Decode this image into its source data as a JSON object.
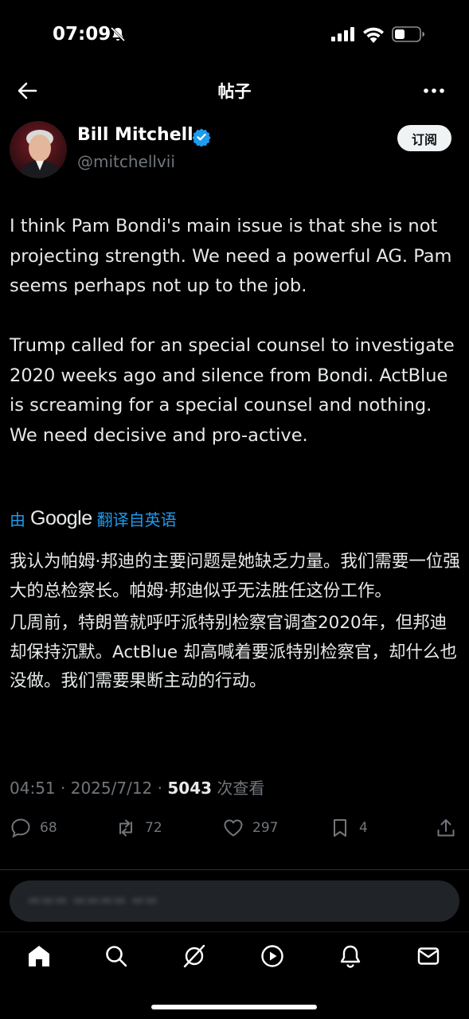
{
  "status_bar": {
    "time": "07:09"
  },
  "header": {
    "title": "帖子"
  },
  "author": {
    "name": "Bill Mitchell",
    "handle": "@mitchellvii",
    "subscribe_label": "订阅"
  },
  "tweet": {
    "paragraphs": [
      "I think Pam Bondi's main issue is that she is not projecting strength.  We need a powerful AG.  Pam seems perhaps not up to the job.",
      "Trump called for an special counsel to investigate 2020 weeks ago and silence from Bondi.  ActBlue is screaming for a special counsel and nothing.  We need decisive and pro-active."
    ]
  },
  "translation": {
    "prefix": "由",
    "provider": "Google",
    "suffix": "翻译自英语",
    "paragraphs": [
      "我认为帕姆·邦迪的主要问题是她缺乏力量。我们需要一位强大的总检察长。帕姆·邦迪似乎无法胜任这份工作。",
      "几周前，特朗普就呼吁派特别检察官调查2020年，但邦迪却保持沉默。ActBlue 却高喊着要派特别检察官，却什么也没做。我们需要果断主动的行动。"
    ]
  },
  "meta": {
    "time": "04:51",
    "date": "2025/7/12",
    "views": "5043",
    "views_label": "次查看",
    "sep": "·"
  },
  "actions": {
    "replies": "68",
    "reposts": "72",
    "likes": "297",
    "bookmarks": "4"
  },
  "colors": {
    "background": "#000000",
    "accent": "#1d9bf0",
    "muted": "#71767b",
    "text": "#e7e9ea"
  }
}
